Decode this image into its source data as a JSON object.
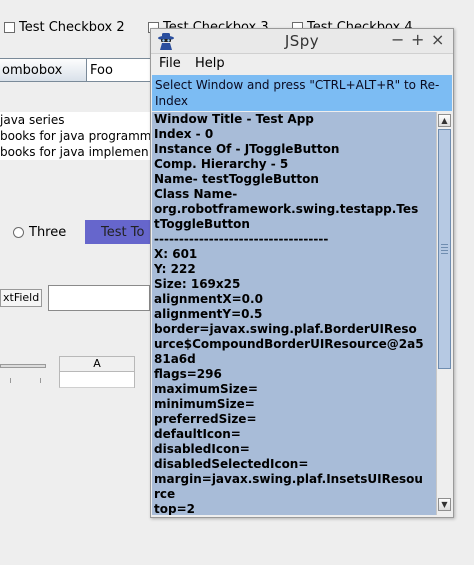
{
  "background_app": {
    "checkboxes": [
      "Test Checkbox 2",
      "Test Checkbox 3",
      "Test Checkbox 4"
    ],
    "combobox_button_label": "ombobox",
    "combobox_value": "Foo",
    "list_items": [
      "java series",
      "books for java programm",
      "books for java implemen"
    ],
    "radio_label": "Three",
    "toggle_button_label": "Test To",
    "textfield_label": "xtField",
    "table_header": "A"
  },
  "jspy": {
    "title": "JSpy",
    "controls": {
      "minimize": "−",
      "maximize": "+",
      "close": "×"
    },
    "menu": {
      "file": "File",
      "help": "Help"
    },
    "info_text": "Select Window and press \"CTRL+ALT+R\" to Re-Index",
    "details": [
      "Window Title - Test App",
      "Index - 0",
      "Instance Of - JToggleButton",
      "Comp. Hierarchy - 5",
      "Name- testToggleButton",
      "Class Name-",
      "org.robotframework.swing.testapp.Tes",
      "tToggleButton",
      "-----------------------------------",
      "X: 601",
      "Y: 222",
      "Size: 169x25",
      "alignmentX=0.0",
      "alignmentY=0.5",
      "border=javax.swing.plaf.BorderUIReso",
      "urce$CompoundBorderUIResource@2a5",
      "81a6d",
      "flags=296",
      "maximumSize=",
      "minimumSize=",
      "preferredSize=",
      "defaultIcon=",
      "disabledIcon=",
      "disabledSelectedIcon=",
      "margin=javax.swing.plaf.InsetsUIResou",
      "rce",
      "top=2"
    ]
  }
}
